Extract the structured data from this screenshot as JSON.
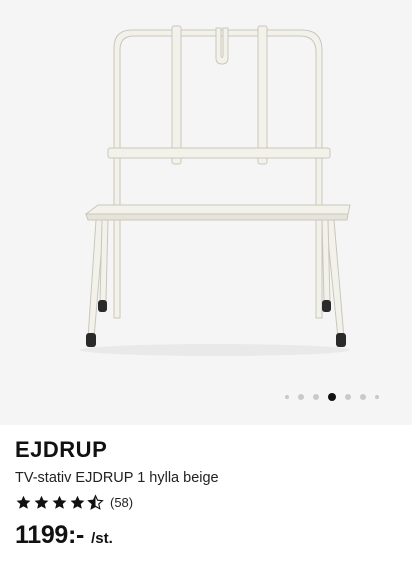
{
  "product": {
    "name": "EJDRUP",
    "description": "TV-stativ EJDRUP 1 hylla beige",
    "rating": 4.5,
    "rating_max": 5,
    "review_count": "(58)",
    "price": "1199:-",
    "price_unit": "/st."
  },
  "carousel": {
    "total": 7,
    "active_index": 3
  },
  "colors": {
    "background": "#f5f5f5",
    "stand": "#f2f1ea",
    "stand_outline": "#c9c7bc",
    "text": "#111111",
    "active_dot": "#111111",
    "inactive_dot": "#c9c9c9"
  }
}
